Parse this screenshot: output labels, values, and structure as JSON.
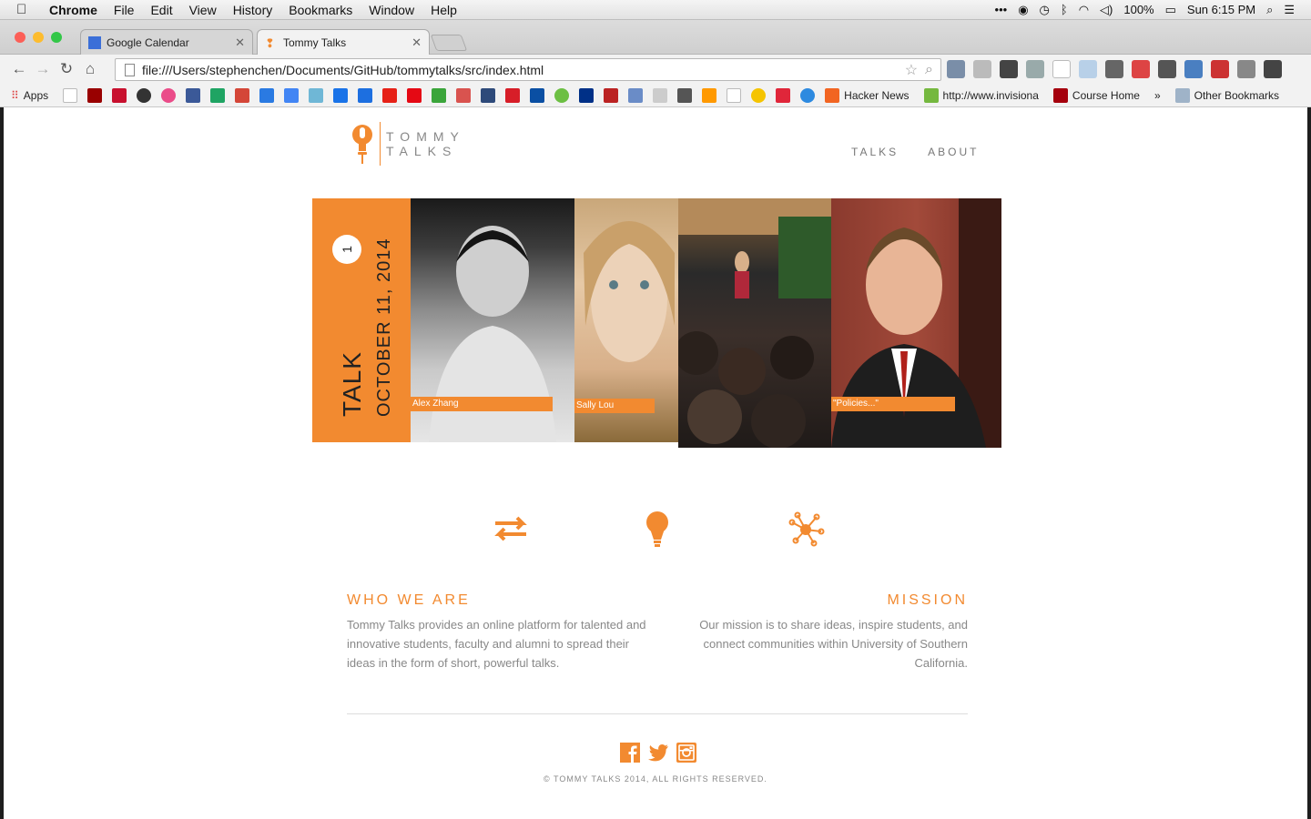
{
  "menubar": {
    "app_name": "Chrome",
    "items": [
      "File",
      "Edit",
      "View",
      "History",
      "Bookmarks",
      "Window",
      "Help"
    ],
    "battery": "100%",
    "clock": "Sun 6:15 PM"
  },
  "tabs": [
    {
      "label": "Google Calendar",
      "active": false,
      "favicon_color": "#3b6fd8"
    },
    {
      "label": "Tommy Talks",
      "active": true,
      "favicon_color": "#f28a30"
    }
  ],
  "address_bar": {
    "url": "file:///Users/stephenchen/Documents/GitHub/tommytalks/src/index.html"
  },
  "bookmarks": {
    "apps_label": "Apps",
    "labeled": [
      {
        "label": "Hacker News",
        "icon_color": "#f26522"
      },
      {
        "label": "http://www.invisiona",
        "icon_color": "#75b83f"
      },
      {
        "label": "Course Home",
        "icon_color": "#a5000d"
      }
    ],
    "overflow": "»",
    "other_label": "Other Bookmarks"
  },
  "site": {
    "brand_line1": "TOMMY",
    "brand_line2": "TALKS",
    "nav": [
      "TALKS",
      "ABOUT"
    ],
    "accent": "#f28a30",
    "hero": {
      "talk_label": "TALK",
      "talk_number": "1",
      "talk_date": "OCTOBER 11, 2014",
      "captions": [
        "Alex Zhang",
        "Sally Lou",
        "\"Policies...\""
      ]
    },
    "features": {
      "icons": [
        "exchange-arrows-icon",
        "lightbulb-icon",
        "network-icon"
      ]
    },
    "who_we_are": {
      "heading": "WHO WE ARE",
      "body": "Tommy Talks provides an online platform for talented and innovative students, faculty and alumni to spread their ideas in the form of short, powerful talks."
    },
    "mission": {
      "heading": "MISSION",
      "body": "Our mission is to share ideas, inspire students, and connect communities within University of Southern California."
    },
    "social": [
      "facebook-icon",
      "twitter-icon",
      "instagram-icon"
    ],
    "copyright": "© TOMMY TALKS 2014, ALL RIGHTS RESERVED."
  }
}
